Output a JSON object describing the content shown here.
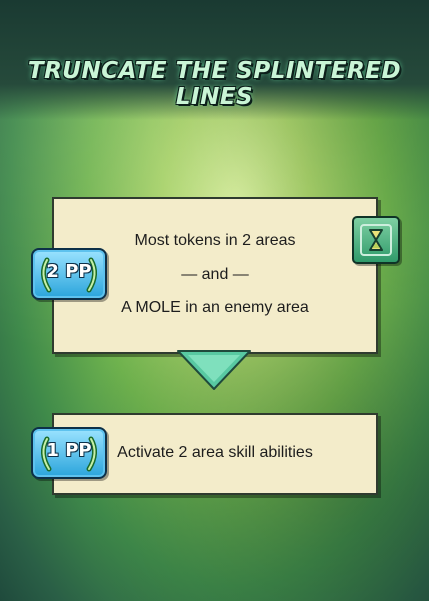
{
  "title": "TRUNCATE THE SPLINTERED LINES",
  "objectives": [
    {
      "badge": "2 PP",
      "lines": [
        "Most tokens in 2 areas",
        "— and —",
        "A MOLE in an enemy area"
      ],
      "icon": "hourglass-icon"
    },
    {
      "badge": "1 PP",
      "lines": [
        "Activate 2 area skill abilities"
      ]
    }
  ],
  "colors": {
    "panel": "#f3ecca",
    "badge": "#2aa4db",
    "timer": "#2f9a6a",
    "title": "#c9f5d6"
  }
}
